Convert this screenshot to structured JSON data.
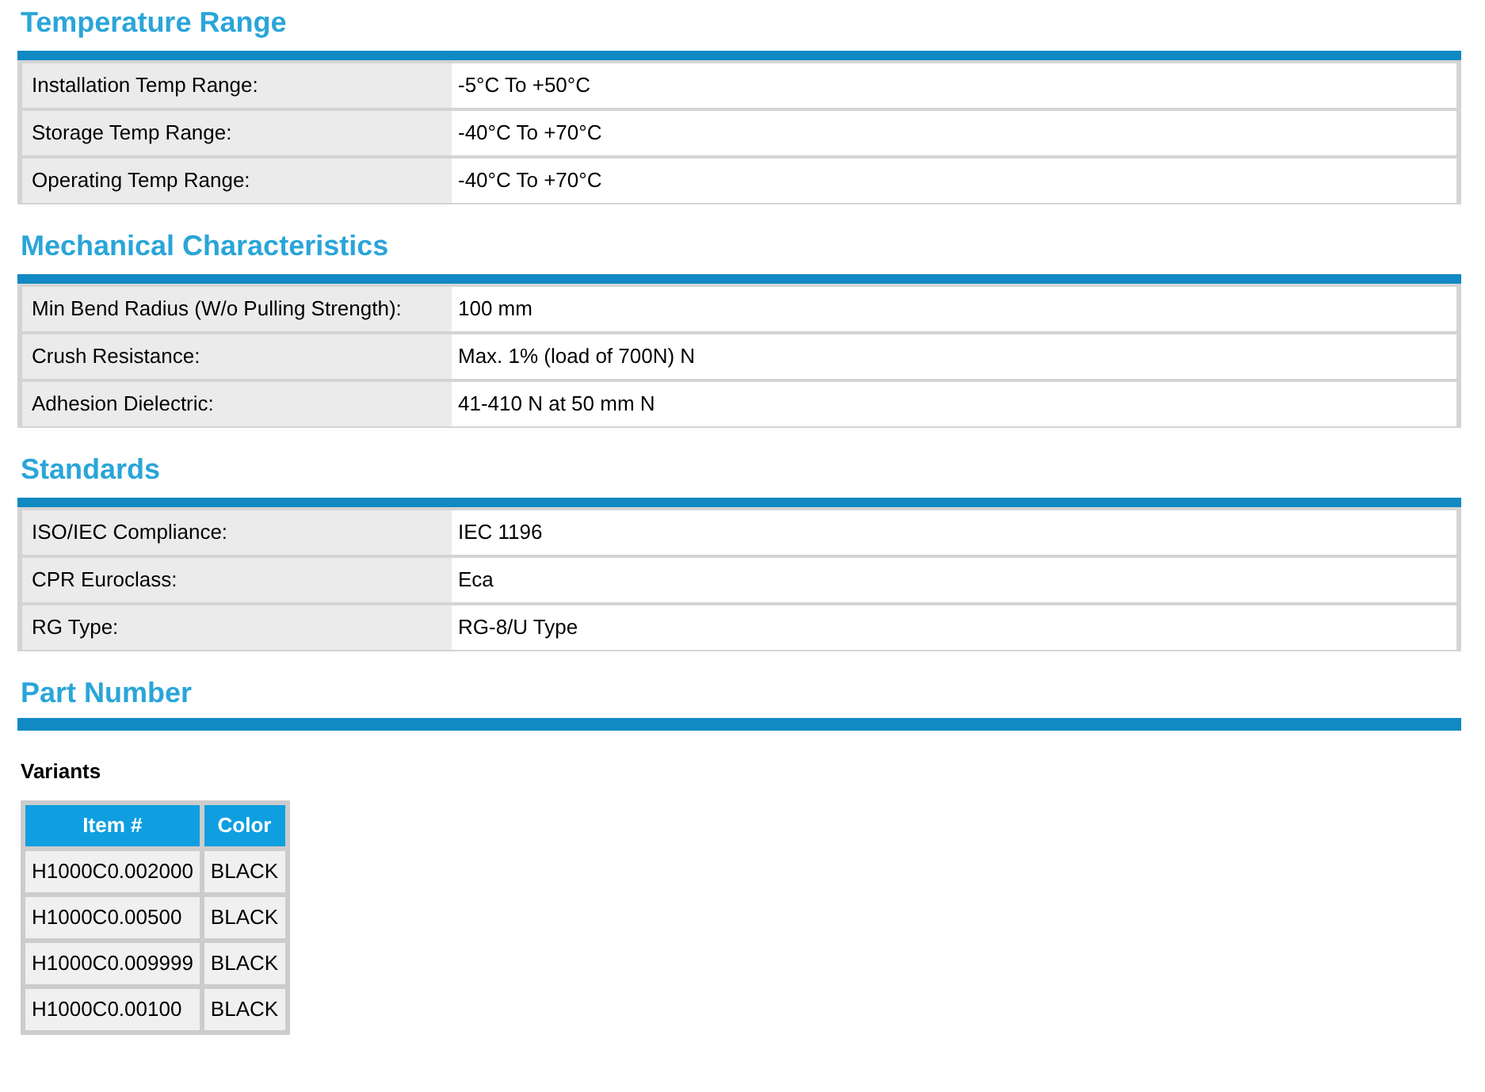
{
  "sections": [
    {
      "title": "Temperature Range",
      "rows": [
        {
          "label": "Installation Temp Range:",
          "value": "-5°C To +50°C"
        },
        {
          "label": "Storage Temp Range:",
          "value": "-40°C To +70°C"
        },
        {
          "label": "Operating Temp Range:",
          "value": "-40°C To +70°C"
        }
      ]
    },
    {
      "title": "Mechanical Characteristics",
      "rows": [
        {
          "label": "Min Bend Radius (W/o Pulling Strength):",
          "value": "100 mm"
        },
        {
          "label": "Crush Resistance:",
          "value": "Max. 1% (load of 700N) N"
        },
        {
          "label": "Adhesion Dielectric:",
          "value": "41-410 N at 50 mm N"
        }
      ]
    },
    {
      "title": "Standards",
      "rows": [
        {
          "label": "ISO/IEC Compliance:",
          "value": "IEC 1196"
        },
        {
          "label": "CPR Euroclass:",
          "value": "Eca"
        },
        {
          "label": "RG Type:",
          "value": "RG-8/U Type"
        }
      ]
    }
  ],
  "part_number": {
    "title": "Part Number",
    "subtitle": "Variants",
    "columns": [
      "Item #",
      "Color"
    ],
    "rows": [
      [
        "H1000C0.002000",
        "BLACK"
      ],
      [
        "H1000C0.00500",
        "BLACK"
      ],
      [
        "H1000C0.009999",
        "BLACK"
      ],
      [
        "H1000C0.00100",
        "BLACK"
      ]
    ]
  }
}
